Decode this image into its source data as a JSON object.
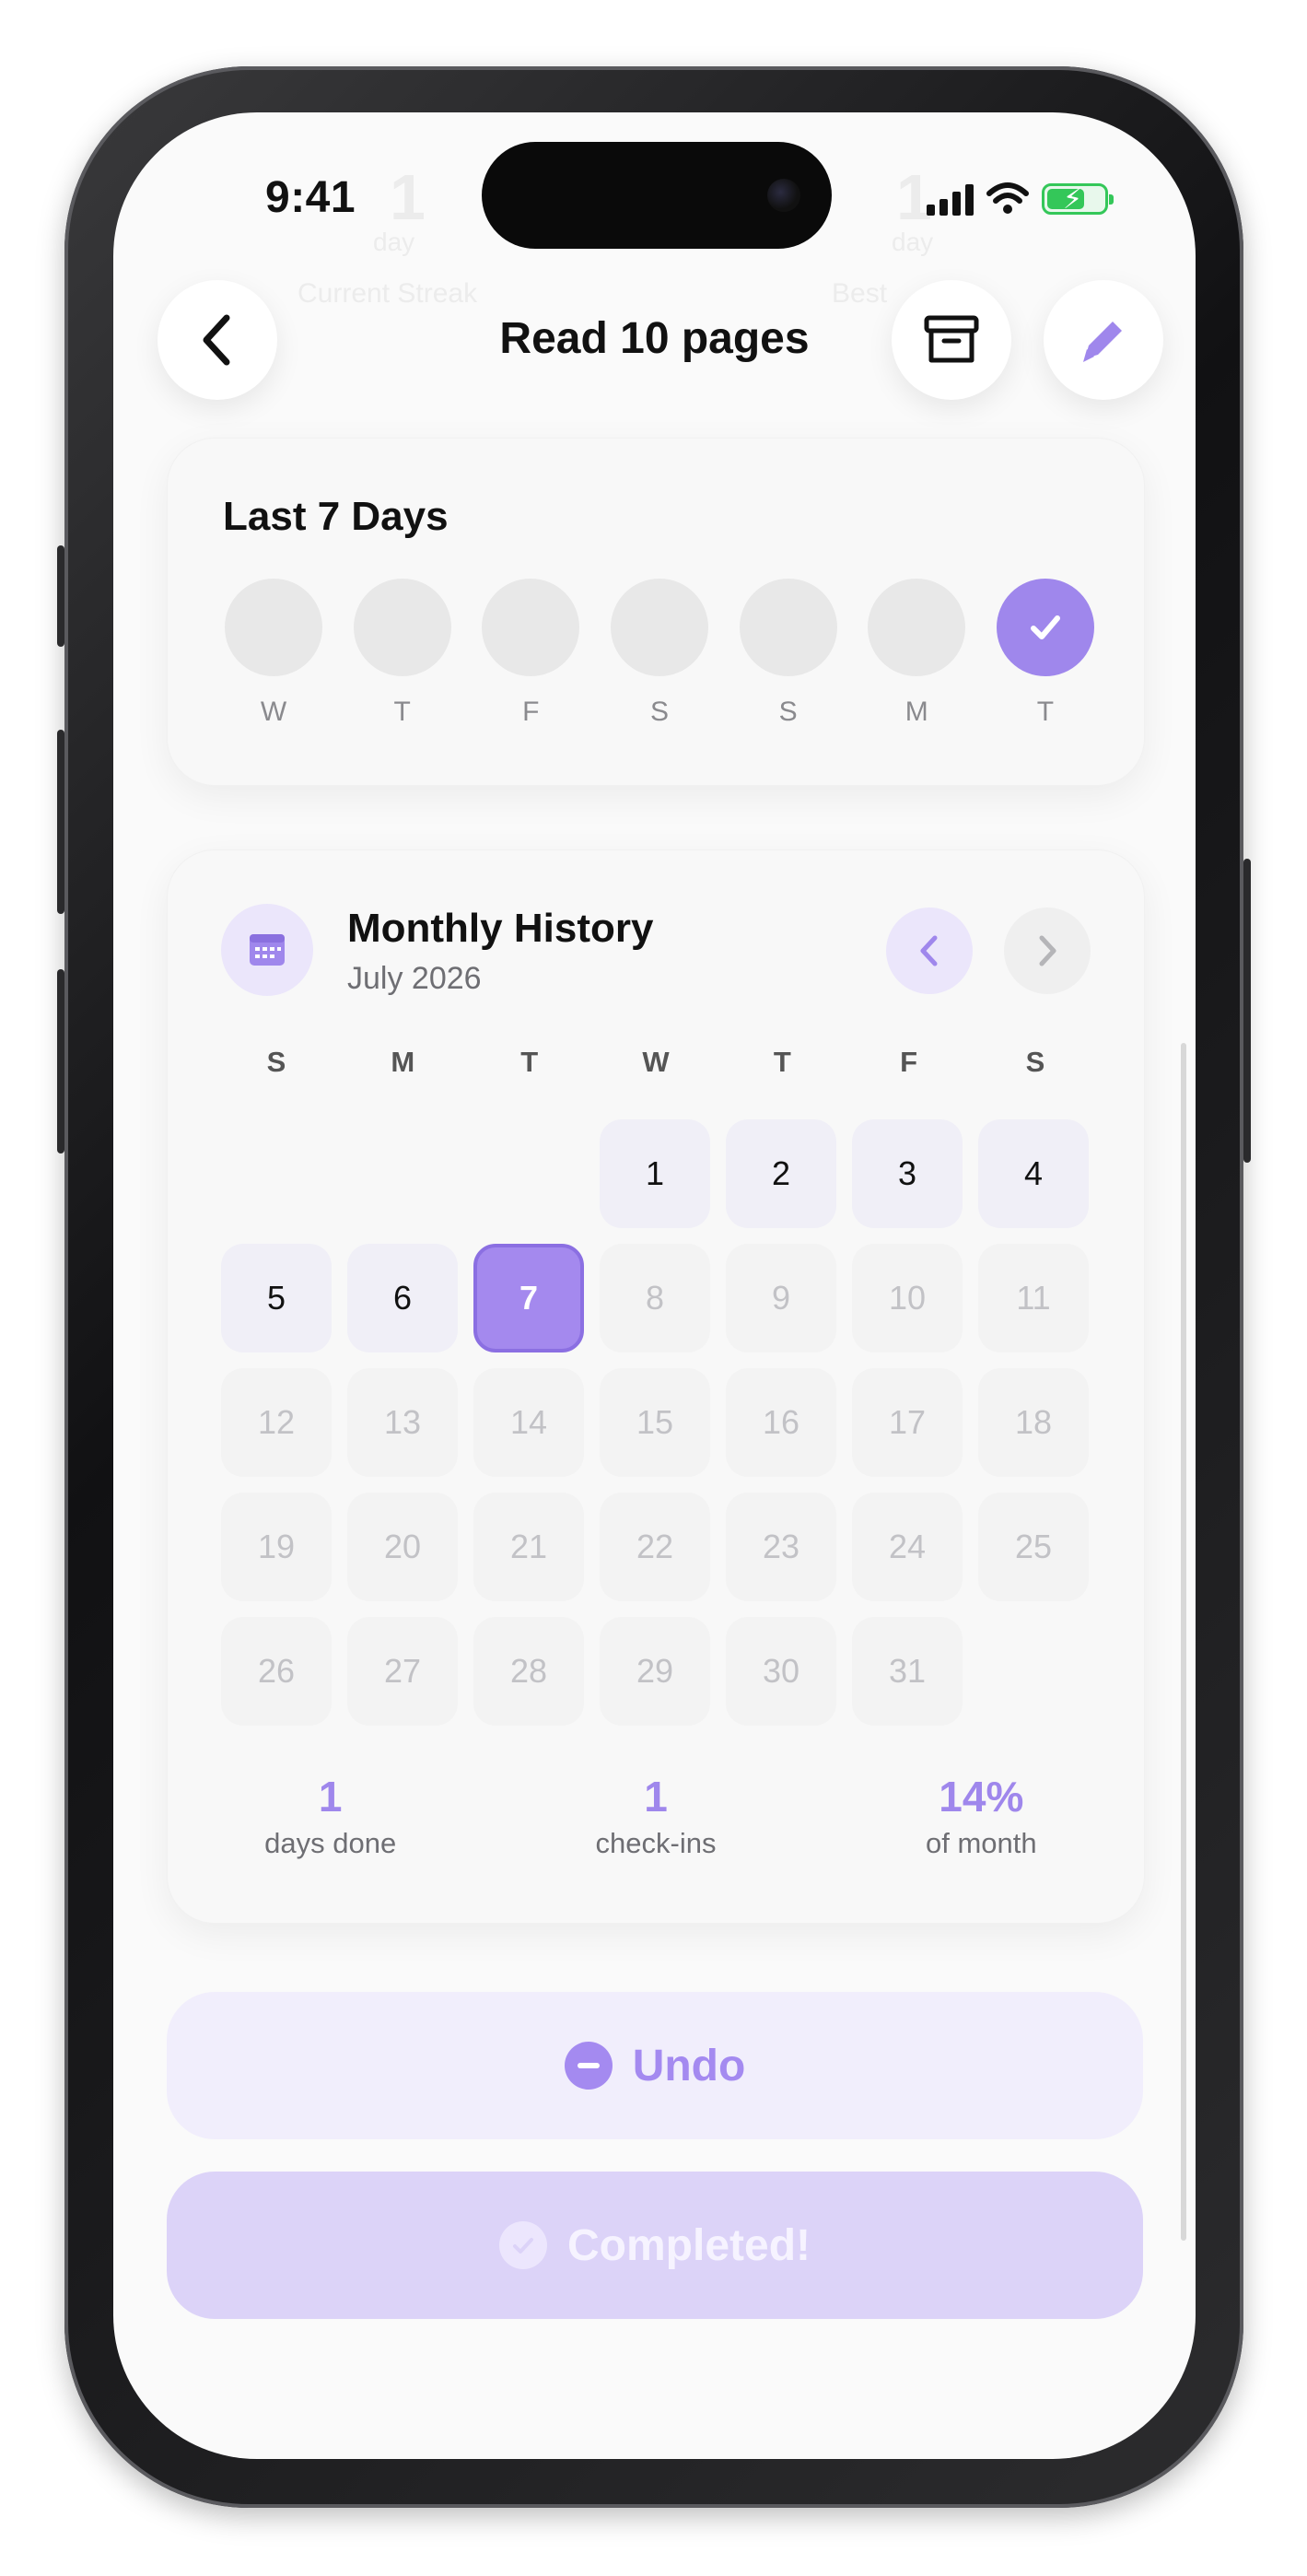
{
  "status_bar": {
    "time": "9:41"
  },
  "header": {
    "title": "Read 10 pages"
  },
  "background_ghost": {
    "left_value": "1",
    "left_unit": "day",
    "left_label": "Current Streak",
    "right_value": "1",
    "right_unit": "day",
    "right_label": "Best"
  },
  "last7": {
    "title": "Last 7 Days",
    "days": [
      {
        "label": "W",
        "done": false
      },
      {
        "label": "T",
        "done": false
      },
      {
        "label": "F",
        "done": false
      },
      {
        "label": "S",
        "done": false
      },
      {
        "label": "S",
        "done": false
      },
      {
        "label": "M",
        "done": false
      },
      {
        "label": "T",
        "done": true
      }
    ]
  },
  "monthly": {
    "title": "Monthly History",
    "subtitle": "July 2026",
    "weekdays": [
      "S",
      "M",
      "T",
      "W",
      "T",
      "F",
      "S"
    ],
    "leading_blanks": 3,
    "days": [
      "1",
      "2",
      "3",
      "4",
      "5",
      "6",
      "7",
      "8",
      "9",
      "10",
      "11",
      "12",
      "13",
      "14",
      "15",
      "16",
      "17",
      "18",
      "19",
      "20",
      "21",
      "22",
      "23",
      "24",
      "25",
      "26",
      "27",
      "28",
      "29",
      "30",
      "31"
    ],
    "today": 7,
    "done_days": [
      7
    ]
  },
  "stats": [
    {
      "value": "1",
      "label": "days done"
    },
    {
      "value": "1",
      "label": "check-ins"
    },
    {
      "value": "14%",
      "label": "of month"
    }
  ],
  "actions": {
    "undo_label": "Undo",
    "completed_label": "Completed!"
  },
  "colors": {
    "accent": "#9f87ec",
    "accent_light": "#f1eefc"
  },
  "icons": [
    "back-icon",
    "archive-icon",
    "edit-icon",
    "calendar-icon",
    "chevron-left-icon",
    "chevron-right-icon",
    "check-icon",
    "minus-icon"
  ]
}
